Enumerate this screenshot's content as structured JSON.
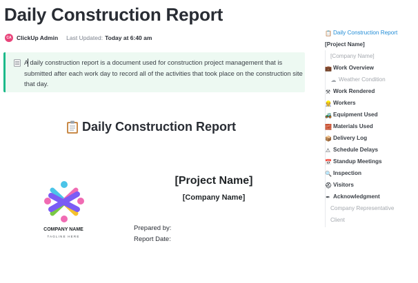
{
  "page": {
    "title": "Daily Construction Report"
  },
  "meta": {
    "avatar_initials": "CA",
    "author": "ClickUp Admin",
    "updated_label": "Last Updated:",
    "updated_value": "Today at 6:40 am"
  },
  "callout": {
    "icon": "notepad-icon",
    "text": "A daily construction report is a document used for construction project management that is submitted after each work day to record all of the activities that took place on the construction site that day."
  },
  "document": {
    "heading": "Daily Construction Report",
    "heading_icon": "clipboard-icon",
    "project_name": "[Project Name]",
    "company_name": "[Company Name]",
    "prepared_by_label": "Prepared by:",
    "report_date_label": "Report Date:"
  },
  "logo": {
    "company_name": "COMPANY NAME",
    "tagline": "TAGLINE HERE",
    "colors": [
      "#7b5cf5",
      "#4bc4e8",
      "#f06bb3",
      "#7ac943",
      "#f5c22d"
    ]
  },
  "toc": {
    "items": [
      {
        "label": "Daily Construction Report",
        "icon": "clipboard-icon",
        "glyph": "📋"
      },
      {
        "label": "[Project Name]",
        "icon": "",
        "glyph": ""
      },
      {
        "label": "[Company Name]",
        "icon": "",
        "glyph": ""
      },
      {
        "label": "Work Overview",
        "icon": "briefcase-icon",
        "glyph": "💼"
      },
      {
        "label": "Weather Condition",
        "icon": "cloud-icon",
        "glyph": "☁"
      },
      {
        "label": "Work Rendered",
        "icon": "tools-icon",
        "glyph": "⚒"
      },
      {
        "label": "Workers",
        "icon": "worker-icon",
        "glyph": "👷"
      },
      {
        "label": "Equipment Used",
        "icon": "tractor-icon",
        "glyph": "🚜"
      },
      {
        "label": "Materials Used",
        "icon": "bricks-icon",
        "glyph": "🧱"
      },
      {
        "label": "Delivery Log",
        "icon": "package-icon",
        "glyph": "📦"
      },
      {
        "label": "Schedule Delays",
        "icon": "warning-icon",
        "glyph": "⚠"
      },
      {
        "label": "Standup Meetings",
        "icon": "calendar-icon",
        "glyph": "📅"
      },
      {
        "label": "Inspection",
        "icon": "magnifier-icon",
        "glyph": "🔍"
      },
      {
        "label": "Visitors",
        "icon": "hardhat-icon",
        "glyph": "⛑"
      },
      {
        "label": "Acknowledgment",
        "icon": "pen-icon",
        "glyph": "✒"
      },
      {
        "label": "Company Representative",
        "icon": "",
        "glyph": ""
      },
      {
        "label": "Client",
        "icon": "",
        "glyph": ""
      }
    ]
  },
  "colors": {
    "accent_green": "#1dba8a",
    "callout_bg": "#edf9f2",
    "toc_active": "#1f8bd6",
    "avatar": "#e8447a"
  }
}
